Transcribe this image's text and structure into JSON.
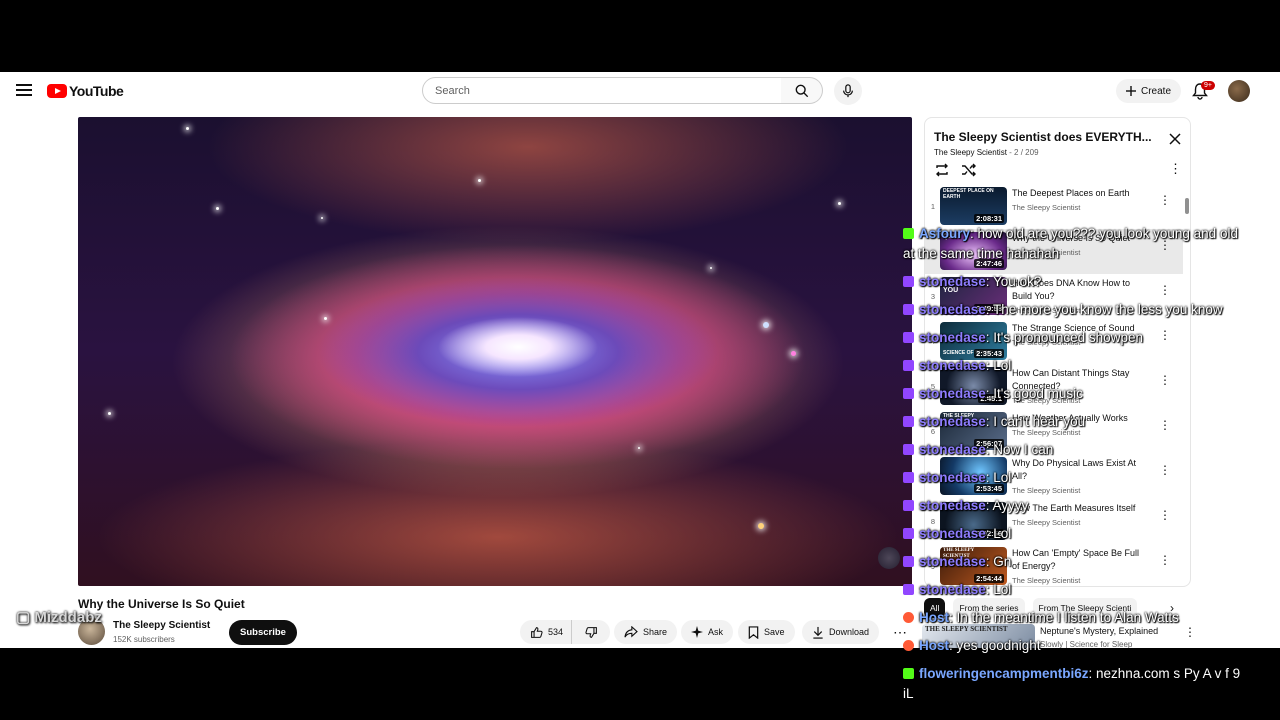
{
  "header": {
    "logo_text": "YouTube",
    "search_placeholder": "Search",
    "create_label": "Create",
    "notif_badge": "9+"
  },
  "video": {
    "title": "Why the Universe Is So Quiet",
    "channel": "The Sleepy Scientist",
    "subscribers": "152K subscribers",
    "subscribe_label": "Subscribe",
    "likes": "534",
    "share_label": "Share",
    "ask_label": "Ask",
    "save_label": "Save",
    "download_label": "Download"
  },
  "playlist": {
    "title": "The Sleepy Scientist does EVERYTH...",
    "channel": "The Sleepy Scientist",
    "position": "- 2 / 209",
    "items": [
      {
        "num": "1",
        "title": "The Deepest Places on Earth",
        "channel": "The Sleepy Scientist",
        "duration": "2:08:31",
        "thumb_text": "DEEPEST PLACE ON EARTH"
      },
      {
        "num": "",
        "title": "Why the Universe Is So Quiet",
        "channel": "The Sleepy Scientist",
        "duration": "2:47:46",
        "thumb_text": "QUIET"
      },
      {
        "num": "3",
        "title": "How Does DNA Know How to Build You?",
        "channel": "The Sleepy Scientist",
        "duration": "2:49:58",
        "thumb_text": "YOU"
      },
      {
        "num": "4",
        "title": "The Strange Science of Sound",
        "channel": "The Sleepy Scientist",
        "duration": "2:35:43",
        "thumb_text": "SCIENCE OF SOUND"
      },
      {
        "num": "5",
        "title": "How Can Distant Things Stay Connected?",
        "channel": "The Sleepy Scientist",
        "duration": "2:45:1",
        "thumb_text": ""
      },
      {
        "num": "6",
        "title": "How Weather Actually Works",
        "channel": "The Sleepy Scientist",
        "duration": "2:56:07",
        "thumb_text": "THE SLEEPY"
      },
      {
        "num": "7",
        "title": "Why Do Physical Laws Exist At All?",
        "channel": "The Sleepy Scientist",
        "duration": "2:53:45",
        "thumb_text": ""
      },
      {
        "num": "8",
        "title": "How The Earth Measures Itself",
        "channel": "The Sleepy Scientist",
        "duration": "3:02:56",
        "thumb_text": ""
      },
      {
        "num": "9",
        "title": "How Can 'Empty' Space Be Full of Energy?",
        "channel": "The Sleepy Scientist",
        "duration": "2:54:44",
        "thumb_text": "THE SLEEPY SCIENTIST"
      }
    ]
  },
  "chips": [
    "All",
    "From the series",
    "From The Sleepy Scienti"
  ],
  "recommendation": {
    "thumb_text": "THE SLEEPY SCIENTIST",
    "title": "Neptune's Mystery, Explained",
    "subtitle": "Slowly | Science for Sleep"
  },
  "overlay": {
    "streamer": "Mizddabz"
  },
  "chat": [
    {
      "user": "Asfoury",
      "text": ": how old are you??? you look young and old",
      "platform": "kick",
      "color": "blue"
    },
    {
      "user": "",
      "text": "at the same time hahahah",
      "platform": "",
      "color": ""
    },
    {
      "user": "stonedase",
      "text": ": You ok?",
      "platform": "twitch",
      "color": "purple"
    },
    {
      "user": "stonedase",
      "text": ": The more you know the less you know",
      "platform": "twitch",
      "color": "purple"
    },
    {
      "user": "stonedase",
      "text": ": It's pronounced showpen",
      "platform": "twitch",
      "color": "purple"
    },
    {
      "user": "stonedase",
      "text": ": Lol",
      "platform": "twitch",
      "color": "purple"
    },
    {
      "user": "stonedase",
      "text": ": It's good music",
      "platform": "twitch",
      "color": "purple"
    },
    {
      "user": "stonedase",
      "text": ": I can't hear you",
      "platform": "twitch",
      "color": "purple"
    },
    {
      "user": "stonedase",
      "text": ": Now I can",
      "platform": "twitch",
      "color": "purple"
    },
    {
      "user": "stonedase",
      "text": ": Lol",
      "platform": "twitch",
      "color": "purple"
    },
    {
      "user": "stonedase",
      "text": ": Ayyyy",
      "platform": "twitch",
      "color": "purple"
    },
    {
      "user": "stonedase",
      "text": ": Lol",
      "platform": "twitch",
      "color": "purple"
    },
    {
      "user": "stonedase",
      "text": ": Gn",
      "platform": "twitch",
      "color": "purple"
    },
    {
      "user": "stonedase",
      "text": ": Lol",
      "platform": "twitch",
      "color": "purple"
    },
    {
      "user": "Host",
      "text": ": In the meantime I listen to Alan Watts",
      "platform": "restream",
      "color": "blue"
    },
    {
      "user": "Host",
      "text": ": yes goodnight",
      "platform": "restream",
      "color": "blue"
    },
    {
      "user": "floweringencampmentbi6z",
      "text": ": nezhna.com s Py A v f 9",
      "platform": "kick",
      "color": "blue"
    },
    {
      "user": "",
      "text": "iL",
      "platform": "",
      "color": ""
    }
  ],
  "colors": {
    "brand_red": "#ff0000",
    "kick_green": "#53fc18",
    "twitch_purple": "#9146ff"
  }
}
